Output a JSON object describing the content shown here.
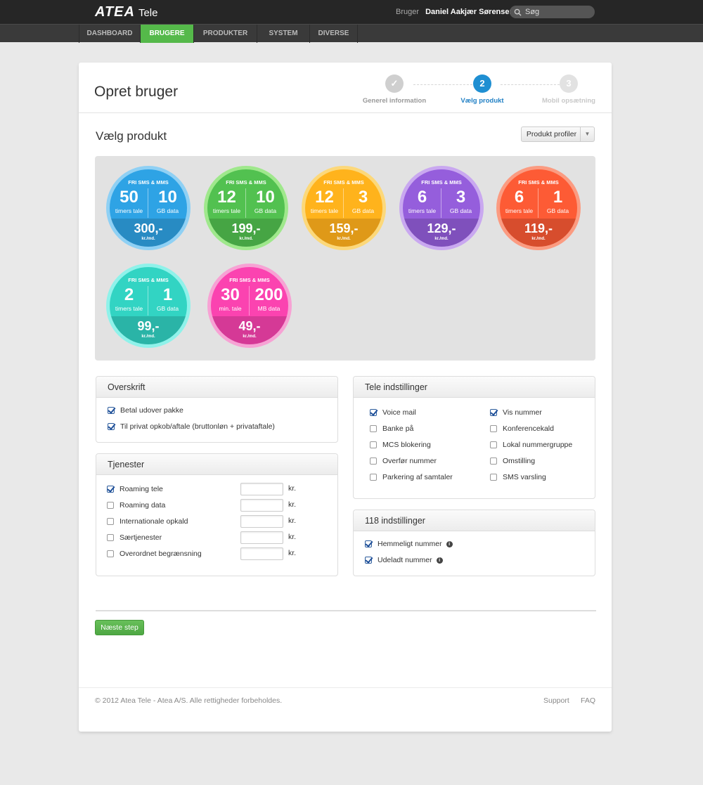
{
  "header": {
    "logo_text": "ATEA",
    "logo_sub": "Tele",
    "user_label": "Bruger",
    "user_name": "Daniel Aakjær Sørensen",
    "search_placeholder": "Søg"
  },
  "nav": {
    "tabs": [
      {
        "label": "DASHBOARD",
        "active": false
      },
      {
        "label": "BRUGERE",
        "active": true
      },
      {
        "label": "PRODUKTER",
        "active": false
      },
      {
        "label": "SYSTEM",
        "active": false
      },
      {
        "label": "DIVERSE",
        "active": false
      }
    ]
  },
  "page": {
    "title": "Opret bruger",
    "steps": [
      {
        "number": "✓",
        "label": "Generel information",
        "state": "done"
      },
      {
        "number": "2",
        "label": "Vælg produkt",
        "state": "active"
      },
      {
        "number": "3",
        "label": "Mobil opsætning",
        "state": "pending"
      }
    ],
    "section_title": "Vælg produkt",
    "profile_dropdown": "Produkt profiler"
  },
  "products": [
    {
      "badge": "FRI SMS & MMS",
      "n1": "50",
      "u1": "timers tale",
      "n2": "10",
      "u2": "GB data",
      "price": "300,-",
      "per": "kr./md.",
      "color": "#2b97d4",
      "ring": "#8fd0f4"
    },
    {
      "badge": "FRI SMS & MMS",
      "n1": "12",
      "u1": "timers tale",
      "n2": "10",
      "u2": "GB data",
      "price": "199,-",
      "per": "kr./md.",
      "color": "#4cb34a",
      "ring": "#9fe88c"
    },
    {
      "badge": "FRI SMS & MMS",
      "n1": "12",
      "u1": "timers tale",
      "n2": "3",
      "u2": "GB data",
      "price": "159,-",
      "per": "kr./md.",
      "color": "#f2a61a",
      "ring": "#fcd87a"
    },
    {
      "badge": "FRI SMS & MMS",
      "n1": "6",
      "u1": "timers tale",
      "n2": "3",
      "u2": "GB data",
      "price": "129,-",
      "per": "kr./md.",
      "color": "#8a57cc",
      "ring": "#c9a8f0"
    },
    {
      "badge": "FRI SMS & MMS",
      "n1": "6",
      "u1": "timers tale",
      "n2": "1",
      "u2": "GB data",
      "price": "119,-",
      "per": "kr./md.",
      "color": "#ea5431",
      "ring": "#fb9b81"
    },
    {
      "badge": "FRI SMS & MMS",
      "n1": "2",
      "u1": "timers tale",
      "n2": "1",
      "u2": "GB data",
      "price": "99,-",
      "per": "kr./md.",
      "color": "#2ec4b5",
      "ring": "#8ff2ea"
    },
    {
      "badge": "FRI SMS & MMS",
      "n1": "30",
      "u1": "min. tale",
      "n2": "200",
      "u2": "MB data",
      "price": "49,-",
      "per": "kr./md.",
      "color": "#e83ea3",
      "ring": "#f7a2d4"
    }
  ],
  "overskrift": {
    "title": "Overskrift",
    "items": [
      {
        "label": "Betal udover pakke",
        "checked": true
      },
      {
        "label": "Til privat opkob/aftale (bruttonløn + privataftale)",
        "checked": true
      }
    ]
  },
  "tjenester": {
    "title": "Tjenester",
    "unit": "kr.",
    "items": [
      {
        "label": "Roaming tele",
        "checked": true,
        "value": ""
      },
      {
        "label": "Roaming data",
        "checked": false,
        "value": ""
      },
      {
        "label": "Internationale opkald",
        "checked": false,
        "value": ""
      },
      {
        "label": "Særtjenester",
        "checked": false,
        "value": ""
      },
      {
        "label": "Overordnet begrænsning",
        "checked": false,
        "value": ""
      }
    ]
  },
  "tele": {
    "title": "Tele indstillinger",
    "left": [
      {
        "label": "Voice mail",
        "checked": true
      },
      {
        "label": "Banke på",
        "checked": false
      },
      {
        "label": "MCS blokering",
        "checked": false
      },
      {
        "label": "Overfør nummer",
        "checked": false
      },
      {
        "label": "Parkering af samtaler",
        "checked": false
      }
    ],
    "right": [
      {
        "label": "Vis nummer",
        "checked": true
      },
      {
        "label": "Konferencekald",
        "checked": false
      },
      {
        "label": "Lokal nummergruppe",
        "checked": false
      },
      {
        "label": "Omstilling",
        "checked": false
      },
      {
        "label": "SMS varsling",
        "checked": false
      }
    ]
  },
  "s118": {
    "title": "118 indstillinger",
    "items": [
      {
        "label": "Hemmeligt nummer",
        "checked": true
      },
      {
        "label": "Udeladt nummer",
        "checked": true
      }
    ]
  },
  "next_button": "Næste step",
  "footer": {
    "copyright": "© 2012 Atea Tele - Atea A/S. Alle rettigheder forbeholdes.",
    "links": [
      "Support",
      "FAQ"
    ]
  }
}
